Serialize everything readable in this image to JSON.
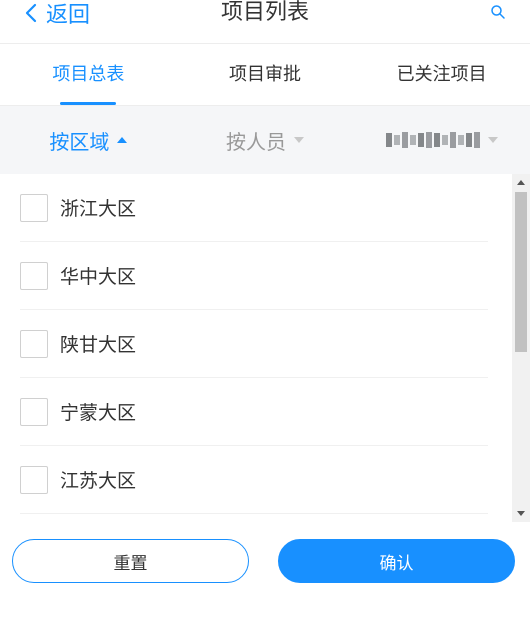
{
  "header": {
    "back_label": "返回",
    "title": "项目列表",
    "search_icon": "search-icon"
  },
  "tabs": [
    {
      "label": "项目总表",
      "active": true
    },
    {
      "label": "项目审批",
      "active": false
    },
    {
      "label": "已关注项目",
      "active": false
    }
  ],
  "filters": [
    {
      "label": "按区域",
      "active": true,
      "caret": "up"
    },
    {
      "label": "按人员",
      "active": false,
      "caret": "down"
    },
    {
      "label": "",
      "active": false,
      "caret": "down",
      "obscured": true
    }
  ],
  "regions": [
    {
      "label": "浙江大区",
      "checked": false
    },
    {
      "label": "华中大区",
      "checked": false
    },
    {
      "label": "陕甘大区",
      "checked": false
    },
    {
      "label": "宁蒙大区",
      "checked": false
    },
    {
      "label": "江苏大区",
      "checked": false
    }
  ],
  "buttons": {
    "reset_label": "重置",
    "confirm_label": "确认"
  },
  "colors": {
    "accent": "#1890ff",
    "filter_bg": "#f5f6f8",
    "inactive_text": "#999999"
  }
}
